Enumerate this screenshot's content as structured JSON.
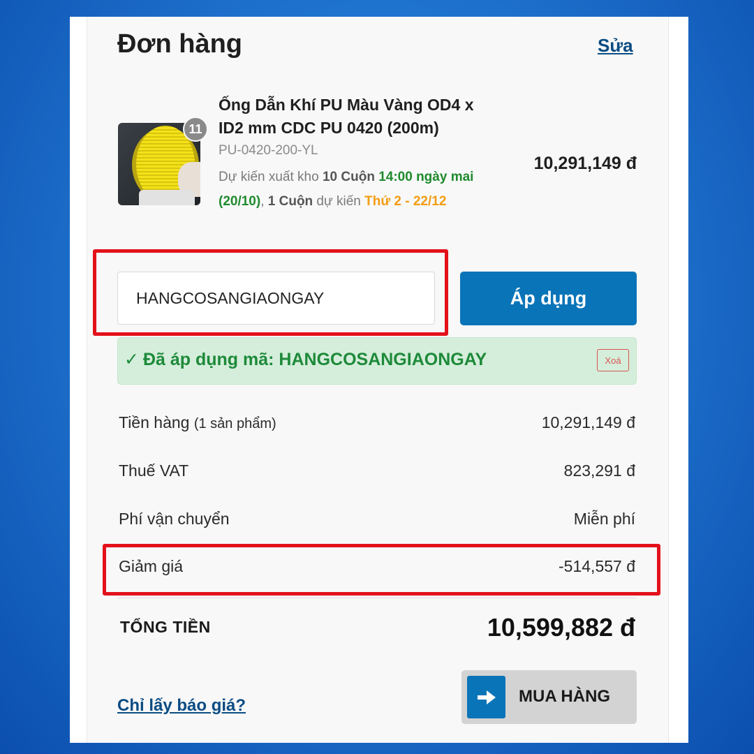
{
  "order": {
    "title": "Đơn hàng",
    "edit_label": "Sửa"
  },
  "product": {
    "quantity_badge": "11",
    "name": "Ống Dẫn Khí PU Màu Vàng OD4 x ID2 mm CDC PU 0420 (200m)",
    "sku": "PU-0420-200-YL",
    "shipping": {
      "prefix": "Dự kiến xuất kho ",
      "qty1": "10 Cuộn",
      "time1": "14:00 ngày mai (20/10)",
      "sep": ", ",
      "qty2": "1 Cuộn",
      "middle": " dự kiến ",
      "time2": "Thứ 2 - 22/12"
    },
    "price": "10,291,149 đ"
  },
  "coupon": {
    "input_value": "HANGCOSANGIAONGAY",
    "apply_label": "Áp dụng",
    "applied_label": "Đã áp dụng mã: HANGCOSANGIAONGAY",
    "remove_label": "Xoá"
  },
  "summary": {
    "subtotal_label": "Tiền hàng",
    "subtotal_sub": "(1 sản phẩm)",
    "subtotal_value": "10,291,149 đ",
    "vat_label": "Thuế VAT",
    "vat_value": "823,291 đ",
    "shipping_label": "Phí vận chuyển",
    "shipping_value": "Miễn phí",
    "discount_label": "Giảm giá",
    "discount_value": "-514,557 đ",
    "total_label": "TỔNG TIỀN",
    "total_value": "10,599,882 đ"
  },
  "actions": {
    "quote_link": "Chỉ lấy báo giá?",
    "buy_label": "MUA HÀNG"
  },
  "colors": {
    "accent_blue": "#0a74b8",
    "highlight_red": "#e3111a",
    "success_green": "#1e8a3a",
    "date_orange": "#f39c12"
  }
}
